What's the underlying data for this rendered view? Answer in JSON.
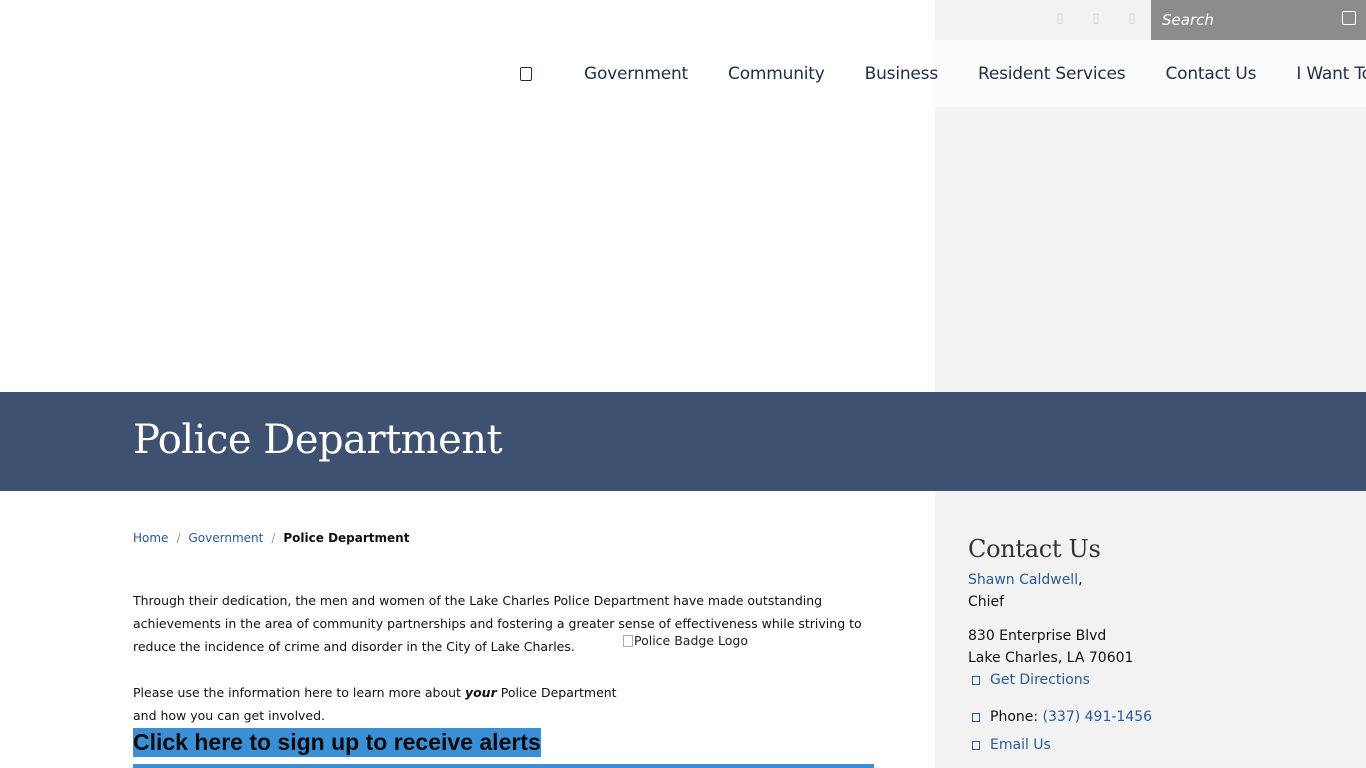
{
  "search": {
    "placeholder": "Search"
  },
  "nav": {
    "items": [
      "Government",
      "Community",
      "Business",
      "Resident Services",
      "Contact Us",
      "I Want To..."
    ]
  },
  "banner": {
    "title": "Police Department"
  },
  "breadcrumb": {
    "home": "Home",
    "section": "Government",
    "current": "Police Department"
  },
  "content": {
    "intro": "Through their dedication, the men and women of the Lake Charles Police Department have made outstanding achievements in the area of community partnerships and fostering a greater sense of effectiveness while striving to reduce the incidence of crime and disorder in the City of Lake Charles.",
    "intro2_before": "Please use the information here to learn more about ",
    "intro2_emph": "your",
    "intro2_after": " Police Department and how you can get involved.",
    "badge_alt": "Police Badge Logo",
    "alert_link": "Click here to sign up to receive alerts"
  },
  "contact": {
    "heading": "Contact Us",
    "name": "Shawn Caldwell",
    "title": "Chief",
    "address1": "830 Enterprise Blvd",
    "address2": "Lake Charles, LA 70601",
    "directions": "Get Directions",
    "phone_label": "Phone: ",
    "phone": "(337) 491-1456",
    "email": "Email Us"
  },
  "colors": {
    "banner": "#3e5170",
    "link": "#2a5b94",
    "alert": "#3a8fd6",
    "search_bg": "#8c8c8c"
  },
  "icons": [
    "facebook-icon",
    "twitter-icon",
    "instagram-icon",
    "search-icon",
    "home-icon",
    "map-icon",
    "phone-icon",
    "email-icon"
  ]
}
